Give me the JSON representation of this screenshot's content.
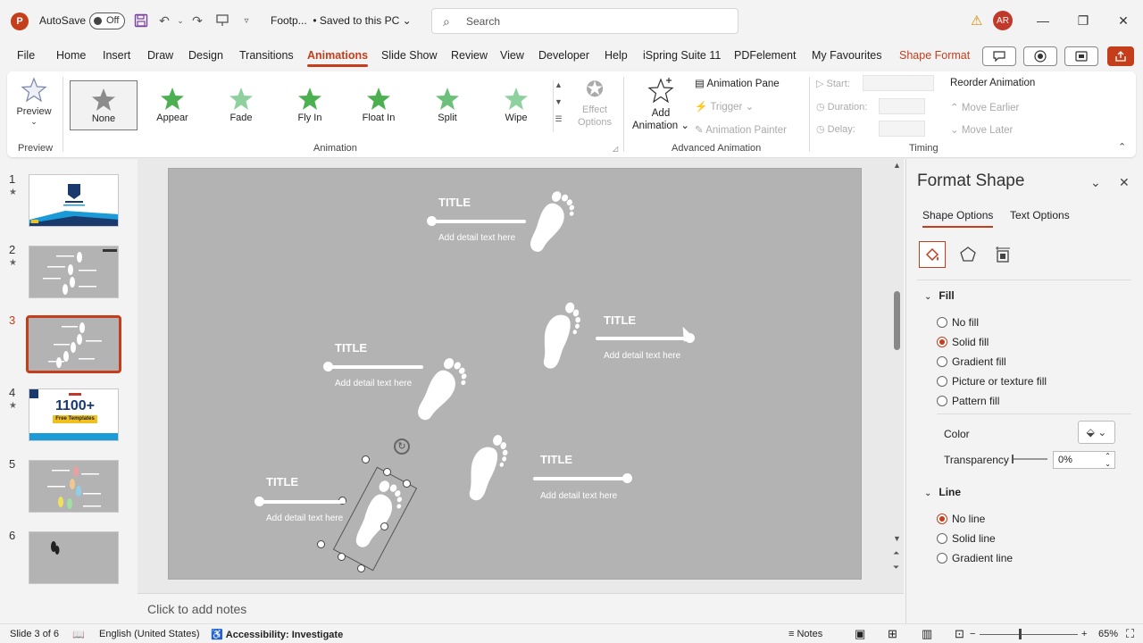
{
  "titlebar": {
    "app_letter": "P",
    "autosave_label": "AutoSave",
    "autosave_state": "Off",
    "doc_title": "Footp...",
    "save_status": "• Saved to this PC",
    "search_placeholder": "Search",
    "avatar_initials": "AR",
    "minimize": "—",
    "restore": "❐",
    "close": "✕"
  },
  "menu": {
    "tabs": [
      "File",
      "Home",
      "Insert",
      "Draw",
      "Design",
      "Transitions",
      "Animations",
      "Slide Show",
      "Review",
      "View",
      "Developer",
      "Help",
      "iSpring Suite 11",
      "PDFelement",
      "My Favourites",
      "Shape Format"
    ],
    "active_tab": "Animations"
  },
  "ribbon": {
    "preview_label": "Preview",
    "group_preview": "Preview",
    "group_animation": "Animation",
    "group_advanced": "Advanced Animation",
    "group_timing": "Timing",
    "animations": [
      {
        "label": "None",
        "color": "#9a9a9a"
      },
      {
        "label": "Appear",
        "color": "#5cb85c"
      },
      {
        "label": "Fade",
        "color": "#7ccf8a"
      },
      {
        "label": "Fly In",
        "color": "#5cb85c"
      },
      {
        "label": "Float In",
        "color": "#5cb85c"
      },
      {
        "label": "Split",
        "color": "#6cc07a"
      },
      {
        "label": "Wipe",
        "color": "#7ccf8a"
      }
    ],
    "effect_options_1": "Effect",
    "effect_options_2": "Options",
    "add_animation_1": "Add",
    "add_animation_2": "Animation",
    "animation_pane": "Animation Pane",
    "trigger": "Trigger",
    "animation_painter": "Animation Painter",
    "start": "Start:",
    "duration": "Duration:",
    "delay": "Delay:",
    "reorder": "Reorder Animation",
    "move_earlier": "Move Earlier",
    "move_later": "Move Later"
  },
  "thumbnails": [
    {
      "num": "1",
      "star": "★"
    },
    {
      "num": "2",
      "star": "★"
    },
    {
      "num": "3",
      "star": ""
    },
    {
      "num": "4",
      "star": "★"
    },
    {
      "num": "5",
      "star": ""
    },
    {
      "num": "6",
      "star": ""
    }
  ],
  "thumb4_text": "1100+",
  "thumb4_sub": "Free Templates",
  "slide": {
    "blocks": [
      {
        "title": "TITLE",
        "detail": "Add detail text here"
      },
      {
        "title": "TITLE",
        "detail": "Add detail text here"
      },
      {
        "title": "TITLE",
        "detail": "Add detail text here"
      },
      {
        "title": "TITLE",
        "detail": "Add detail text here"
      },
      {
        "title": "TITLE",
        "detail": "Add detail text here"
      }
    ]
  },
  "notes_placeholder": "Click to add notes",
  "pane": {
    "title": "Format Shape",
    "tab_shape": "Shape Options",
    "tab_text": "Text Options",
    "fill_header": "Fill",
    "fill_options": [
      "No fill",
      "Solid fill",
      "Gradient fill",
      "Picture or texture fill",
      "Pattern fill"
    ],
    "fill_selected": 1,
    "color_label": "Color",
    "transparency_label": "Transparency",
    "transparency_value": "0%",
    "line_header": "Line",
    "line_options": [
      "No line",
      "Solid line",
      "Gradient line"
    ],
    "line_selected": 0
  },
  "status": {
    "slide_info": "Slide 3 of 6",
    "language": "English (United States)",
    "accessibility": "Accessibility: Investigate",
    "notes": "Notes",
    "zoom": "65%"
  },
  "colors": {
    "accent": "#c43e1c",
    "slide_bg": "#b3b3b3"
  }
}
